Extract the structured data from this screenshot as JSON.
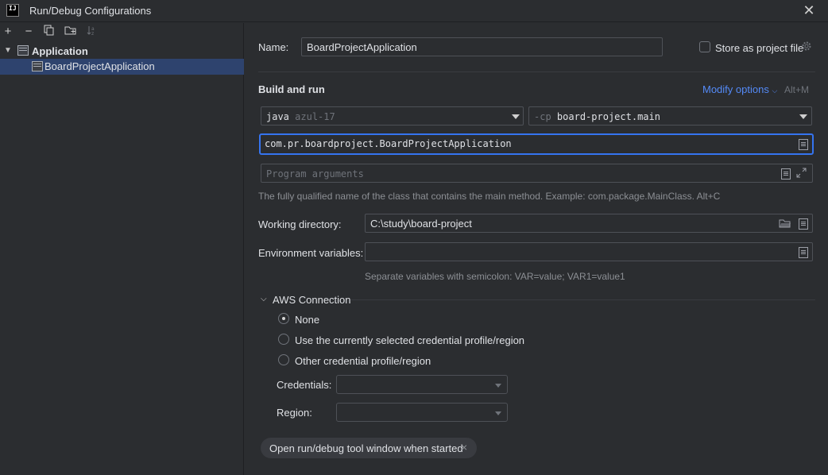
{
  "window": {
    "title": "Run/Debug Configurations",
    "logo": "IJ"
  },
  "toolbar": {
    "add": "+",
    "remove": "−"
  },
  "tree": {
    "group_label": "Application",
    "config_label": "BoardProjectApplication"
  },
  "form": {
    "name_label": "Name:",
    "name_value": "BoardProjectApplication",
    "store_label": "Store as project file",
    "build_run_title": "Build and run",
    "modify_options": "Modify options",
    "modify_shortcut": "Alt+M",
    "jdk_prefix": "java",
    "jdk_value": "azul-17",
    "cp_prefix": "-cp",
    "cp_value": "board-project.main",
    "main_class_value": "com.pr.boardproject.BoardProjectApplication",
    "program_args_placeholder": "Program arguments",
    "main_class_hint": "The fully qualified name of the class that contains the main method. Example: com.package.MainClass. Alt+C",
    "working_dir_label": "Working directory:",
    "working_dir_value": "C:\\study\\board-project",
    "env_label": "Environment variables:",
    "env_value": "",
    "env_hint": "Separate variables with semicolon: VAR=value; VAR1=value1"
  },
  "aws": {
    "section_title": "AWS Connection",
    "options": [
      "None",
      "Use the currently selected credential profile/region",
      "Other credential profile/region"
    ],
    "selected": "None",
    "credentials_label": "Credentials:",
    "region_label": "Region:"
  },
  "chip": {
    "label": "Open run/debug tool window when started",
    "close": "×"
  },
  "colors": {
    "accent": "#548af7",
    "focus": "#3574f0",
    "selection": "#2e436e",
    "background": "#2b2d30"
  }
}
